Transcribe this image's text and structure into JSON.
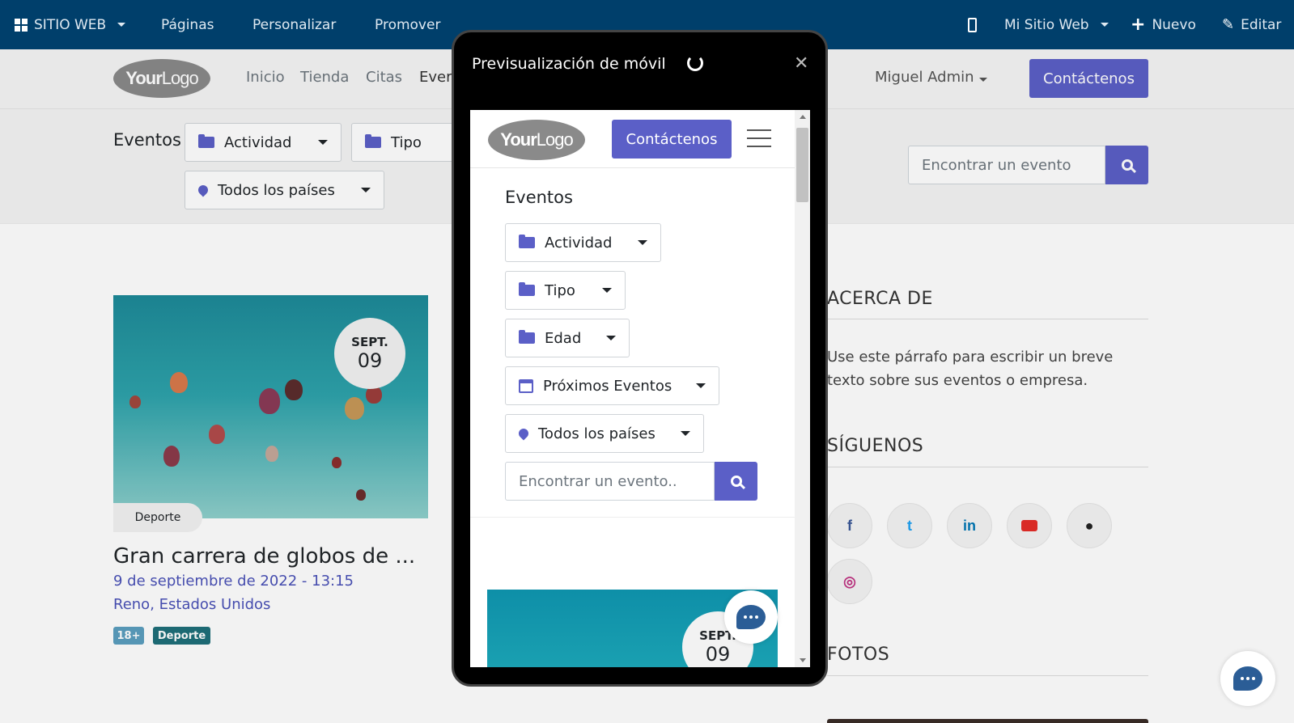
{
  "admin_bar": {
    "website_menu": "SITIO WEB",
    "pages": "Páginas",
    "customize": "Personalizar",
    "promote": "Promover",
    "my_site": "Mi Sitio Web",
    "new": "Nuevo",
    "edit": "Editar"
  },
  "site": {
    "logo_bold": "Your",
    "logo_thin": "Logo",
    "nav": [
      "Inicio",
      "Tienda",
      "Citas",
      "Ever"
    ],
    "user": "Miguel Admin",
    "contact_button": "Contáctenos"
  },
  "filters": {
    "title": "Eventos",
    "activity": "Actividad",
    "type": "Tipo",
    "countries": "Todos los países",
    "search_placeholder": "Encontrar un evento"
  },
  "event": {
    "month": "SEPT.",
    "day": "09",
    "category": "Deporte",
    "title": "Gran carrera de globos de ...",
    "datetime": "9 de septiembre de 2022 - 13:15",
    "location": "Reno, Estados Unidos",
    "badges": [
      "18+",
      "Deporte"
    ]
  },
  "sidebar": {
    "about_title": "ACERCA DE",
    "about_text_1": "Use este párrafo para escribir un breve",
    "about_text_2": "texto sobre sus eventos o empresa.",
    "follow_title": "SÍGUENOS",
    "photos_title": "FOTOS",
    "social_icons": [
      "facebook-icon",
      "twitter-icon",
      "linkedin-icon",
      "youtube-icon",
      "github-icon",
      "instagram-icon"
    ]
  },
  "modal": {
    "title": "Previsualización de móvil",
    "mobile": {
      "contact_button": "Contáctenos",
      "events_title": "Eventos",
      "filters": [
        "Actividad",
        "Tipo",
        "Edad",
        "Próximos Eventos",
        "Todos los países"
      ],
      "search_placeholder": "Encontrar un evento..",
      "month": "SEPT.",
      "day": "09"
    }
  },
  "colors": {
    "admin_bar": "#003f6b",
    "primary": "#5b5fc7",
    "chat": "#2b5d96",
    "badge_age": "#5b9fbf",
    "badge_category": "#1f6f7a"
  }
}
